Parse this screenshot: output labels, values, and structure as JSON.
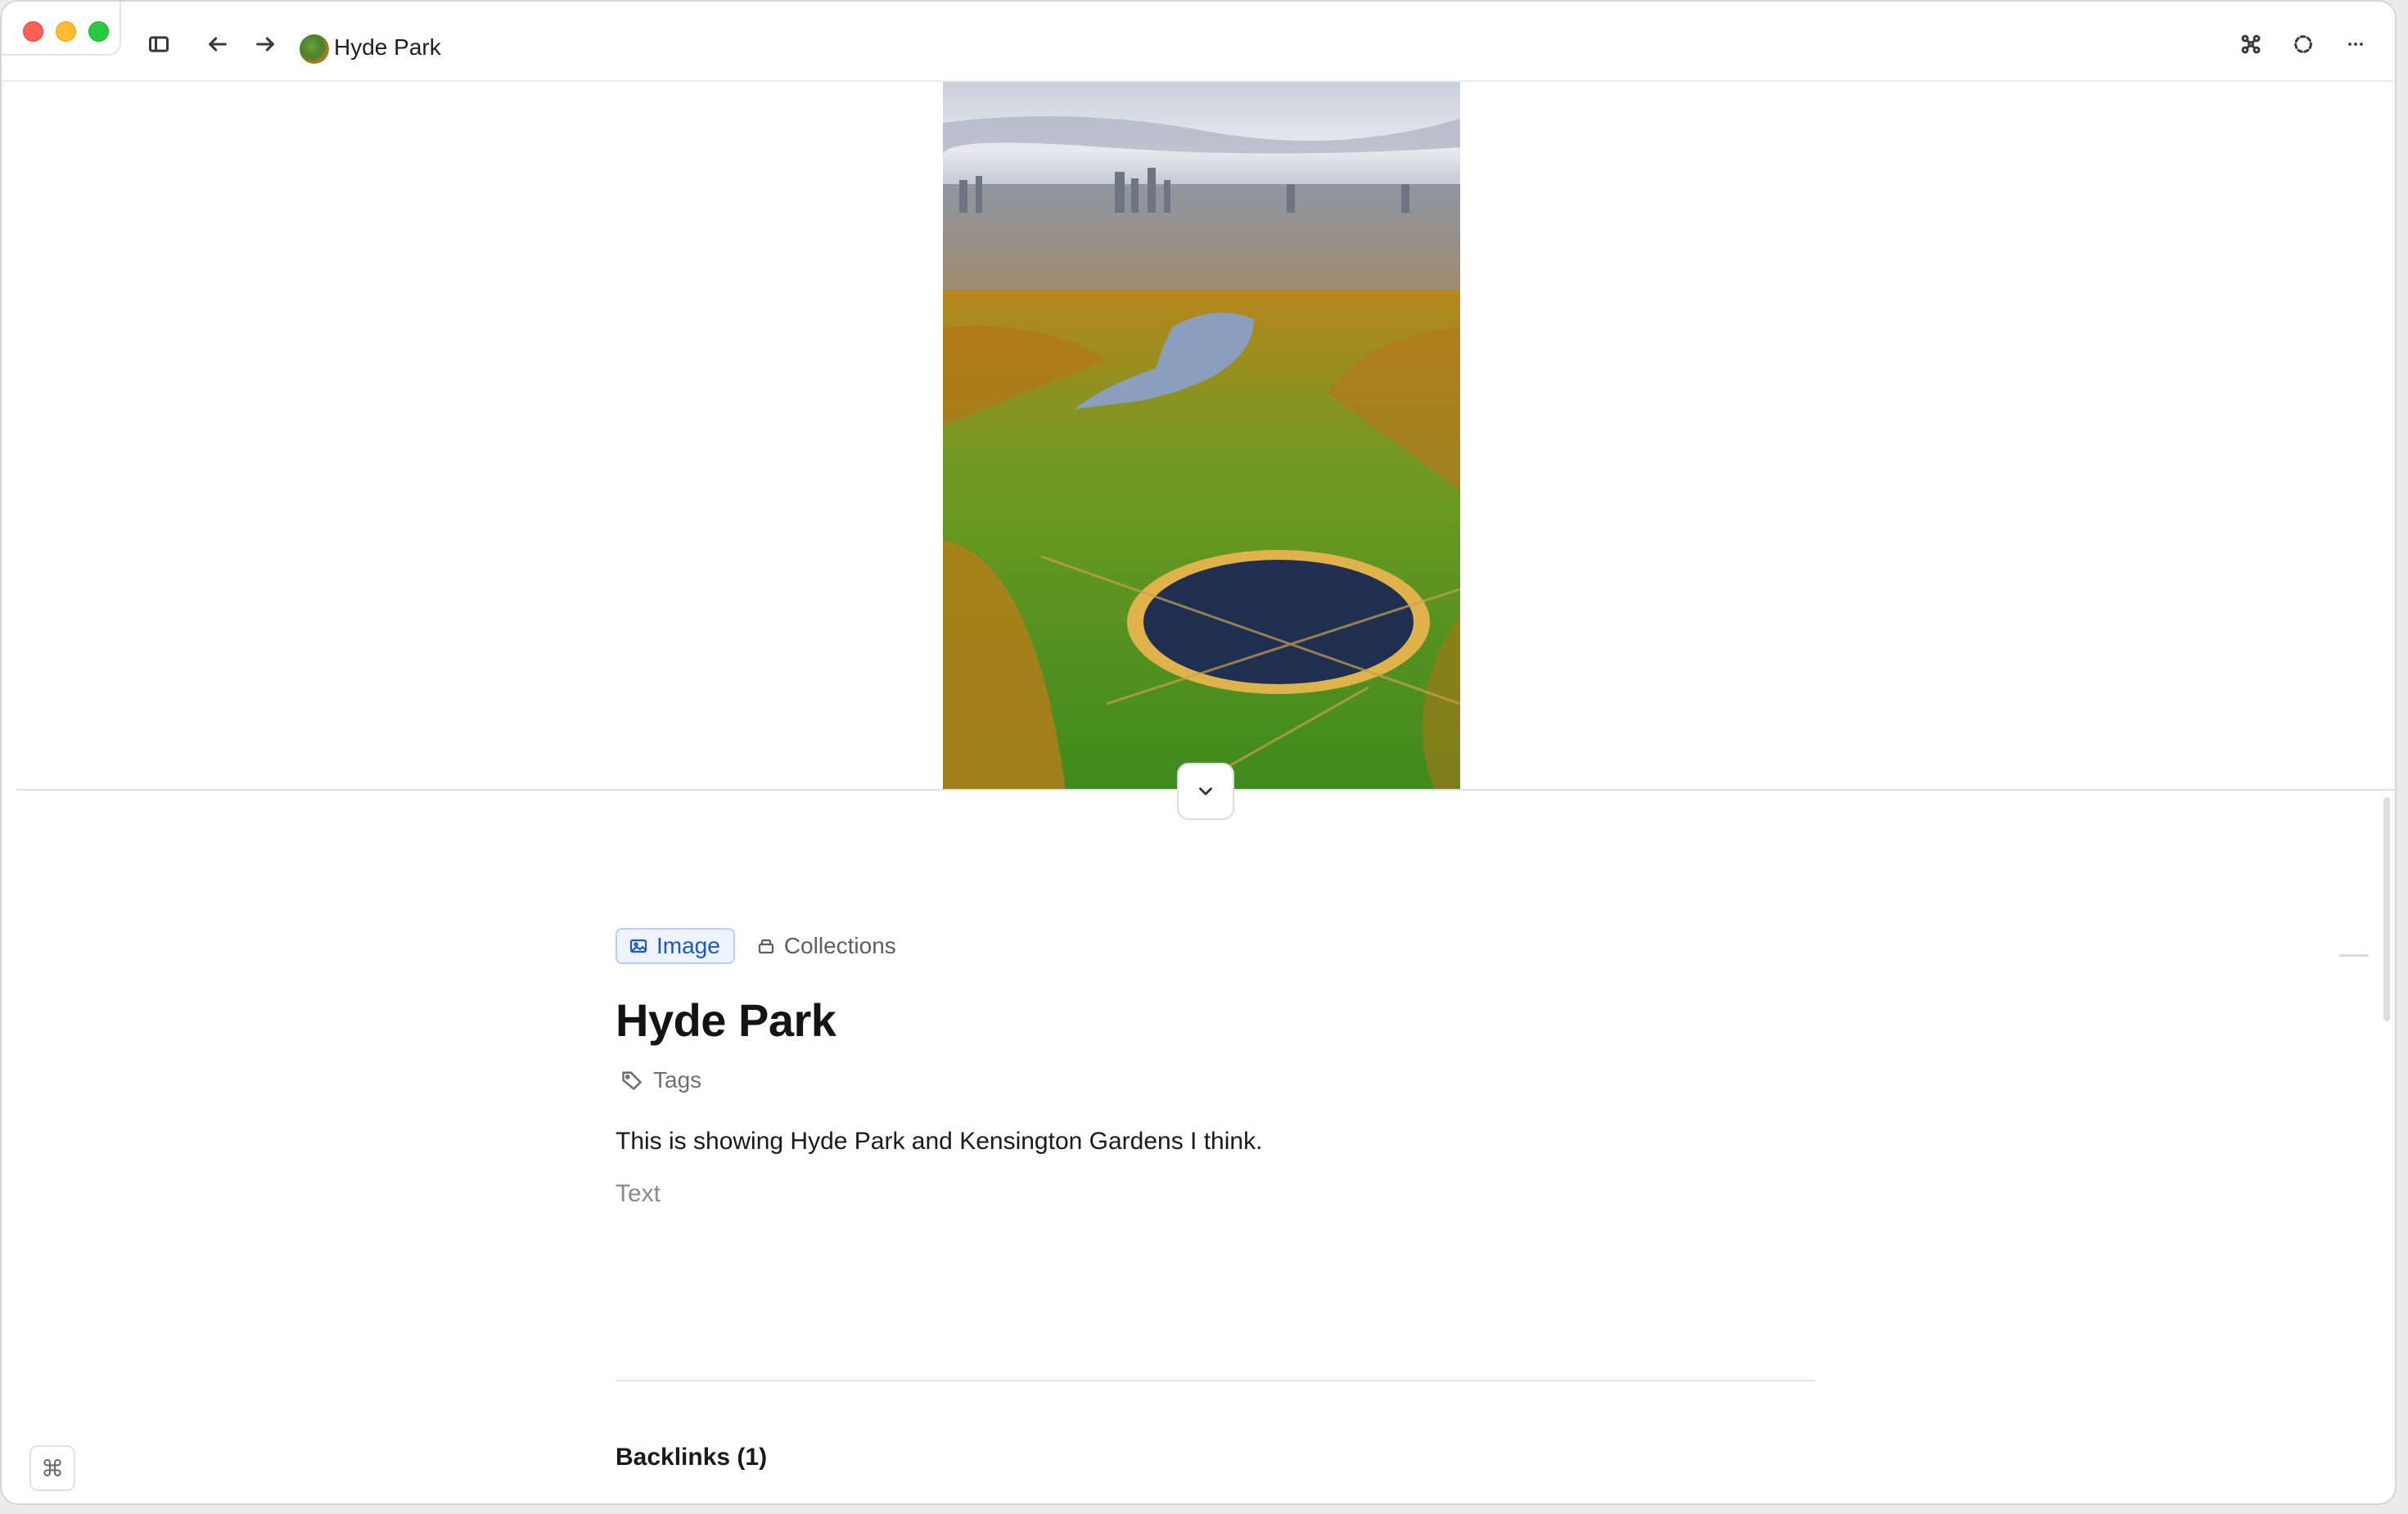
{
  "titlebar": {
    "page_title": "Hyde Park",
    "icons": {
      "sidebar_toggle": "sidebar-toggle-icon",
      "back": "arrow-left-icon",
      "forward": "arrow-right-icon",
      "graph": "graph-icon",
      "sync": "dashed-circle-icon",
      "more": "ellipsis-icon"
    }
  },
  "hero": {
    "image_subject": "aerial-park-photo",
    "collapse_icon": "chevron-down-icon"
  },
  "document": {
    "type_chip_label": "Image",
    "collections_label": "Collections",
    "title": "Hyde Park",
    "tags_label": "Tags",
    "body_text": "This is showing Hyde Park and Kensington Gardens I think.",
    "text_placeholder": "Text",
    "backlinks_label": "Backlinks (1)"
  },
  "footer": {
    "command_glyph": "⌘"
  },
  "colors": {
    "accent": "#1e56c8",
    "chip_bg": "#eef4ff",
    "close": "#ff5f57",
    "minimize": "#febc2e",
    "maximize": "#28c840"
  }
}
